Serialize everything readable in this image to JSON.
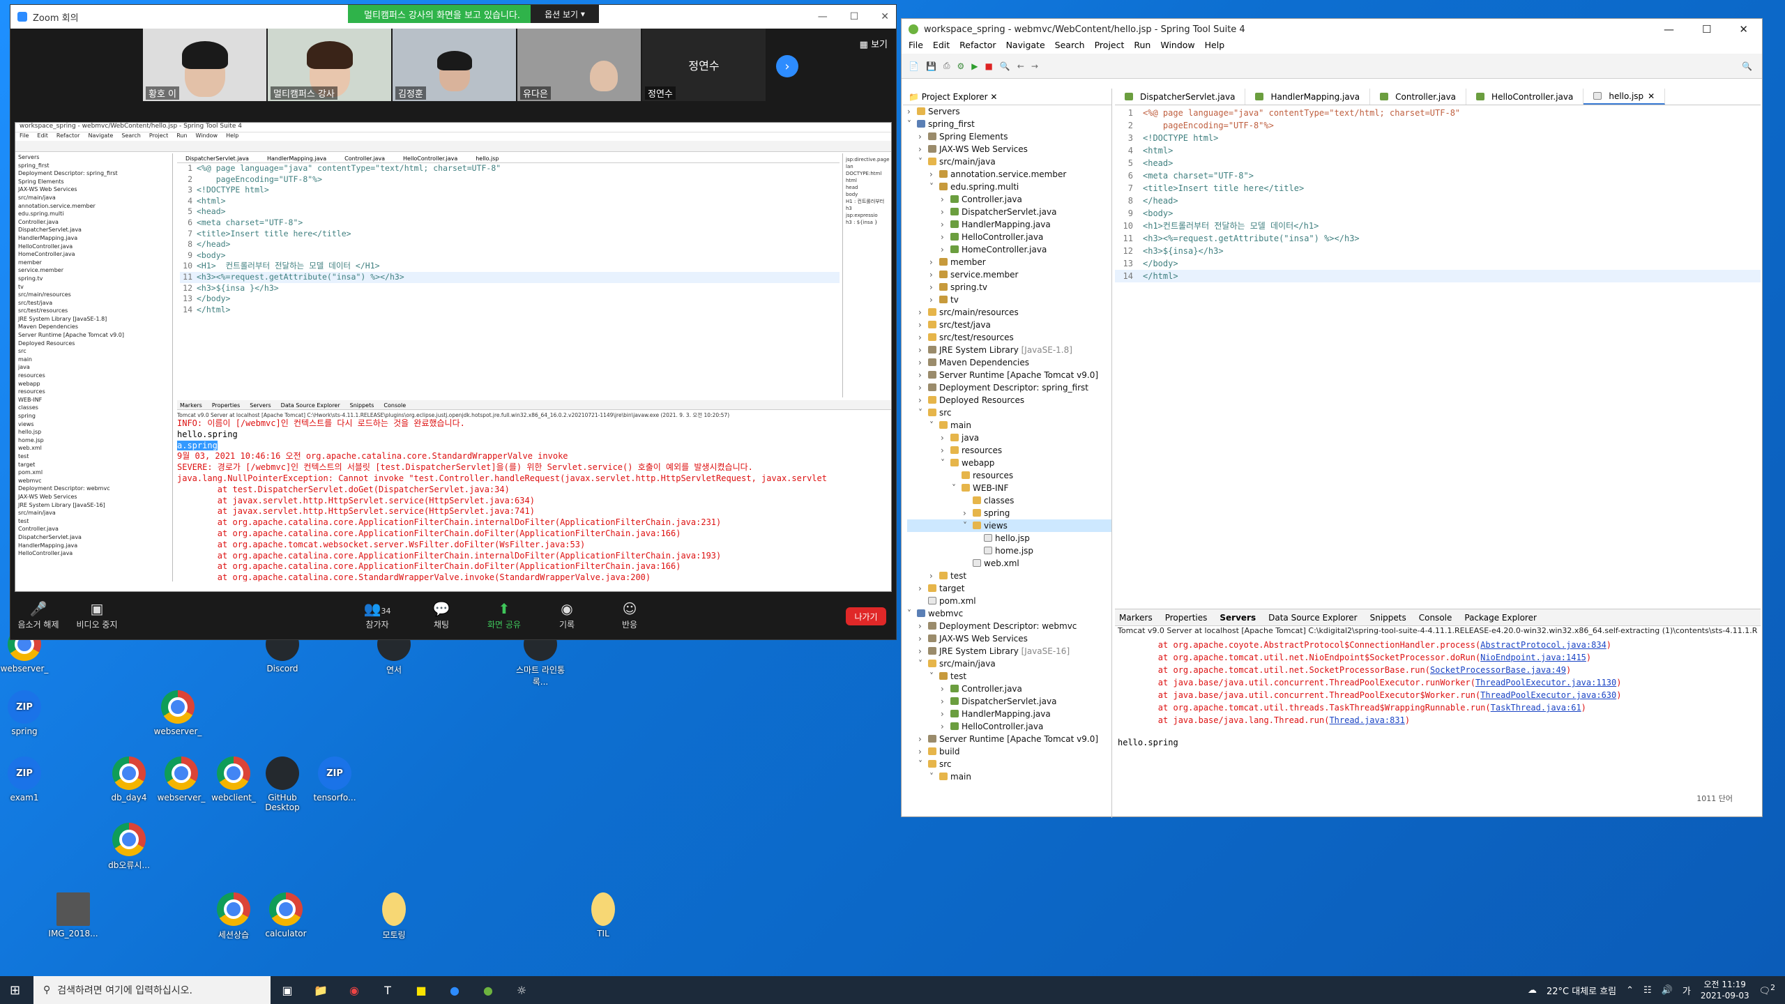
{
  "desktop": {
    "icons": [
      {
        "label": "webserver_",
        "type": "chrome"
      },
      {
        "label": "Discord",
        "type": "app"
      },
      {
        "label": "연서",
        "type": "app"
      },
      {
        "label": "스마트 라인통록...",
        "type": "app"
      },
      {
        "label": "spring",
        "type": "zip"
      },
      {
        "label": "webserver_",
        "type": "chrome"
      },
      {
        "label": "exam1",
        "type": "zip"
      },
      {
        "label": "db_day4",
        "type": "chrome"
      },
      {
        "label": "webserver_",
        "type": "chrome"
      },
      {
        "label": "webclient_",
        "type": "chrome"
      },
      {
        "label": "GitHub Desktop",
        "type": "app"
      },
      {
        "label": "tensorfo...",
        "type": "zip"
      },
      {
        "label": "db오류시...",
        "type": "chrome"
      },
      {
        "label": "IMG_2018...",
        "type": "image"
      },
      {
        "label": "세션상습",
        "type": "chrome"
      },
      {
        "label": "calculator",
        "type": "chrome"
      },
      {
        "label": "모토링",
        "type": "file"
      },
      {
        "label": "TIL",
        "type": "file"
      }
    ]
  },
  "zoom": {
    "title": "Zoom 회의",
    "share_banner": "멀티캠퍼스 강사의 화면을 보고 있습니다.",
    "share_option": "옵션 보기",
    "view_label": "보기",
    "participants": [
      "황호 이",
      "멀티캠퍼스 강사",
      "김정훈",
      "유다은",
      "정연수"
    ],
    "big_name": "정연수",
    "toolbar": {
      "mute": "음소거 해제",
      "video": "비디오 중지",
      "participants": "참가자",
      "participant_count": "34",
      "chat": "채팅",
      "share": "화면 공유",
      "record": "기록",
      "reactions": "반응",
      "leave": "나가기"
    }
  },
  "inner_sts": {
    "title": "workspace_spring - webmvc/WebContent/hello.jsp - Spring Tool Suite 4",
    "menu": [
      "File",
      "Edit",
      "Refactor",
      "Navigate",
      "Search",
      "Project",
      "Run",
      "Window",
      "Help"
    ],
    "tabs": [
      "DispatcherServlet.java",
      "HandlerMapping.java",
      "Controller.java",
      "HelloController.java",
      "hello.jsp"
    ],
    "tree": [
      "Servers",
      "spring_first",
      "Deployment Descriptor: spring_first",
      "Spring Elements",
      "JAX-WS Web Services",
      "src/main/java",
      "annotation.service.member",
      "edu.spring.multi",
      "Controller.java",
      "DispatcherServlet.java",
      "HandlerMapping.java",
      "HelloController.java",
      "HomeController.java",
      "member",
      "service.member",
      "spring.tv",
      "tv",
      "src/main/resources",
      "src/test/java",
      "src/test/resources",
      "JRE System Library [JavaSE-1.8]",
      "Maven Dependencies",
      "Server Runtime [Apache Tomcat v9.0]",
      "Deployed Resources",
      "src",
      "main",
      "java",
      "resources",
      "webapp",
      "resources",
      "WEB-INF",
      "classes",
      "spring",
      "views",
      "hello.jsp",
      "home.jsp",
      "web.xml",
      "test",
      "target",
      "pom.xml",
      "webmvc",
      "Deployment Descriptor: webmvc",
      "JAX-WS Web Services",
      "JRE System Library [JavaSE-16]",
      "src/main/java",
      "test",
      "Controller.java",
      "DispatcherServlet.java",
      "HandlerMapping.java",
      "HelloController.java"
    ],
    "code": [
      "<%@ page language=\"java\" contentType=\"text/html; charset=UTF-8\"",
      "    pageEncoding=\"UTF-8\"%>",
      "<!DOCTYPE html>",
      "<html>",
      "<head>",
      "<meta charset=\"UTF-8\">",
      "<title>Insert title here</title>",
      "</head>",
      "<body>",
      "<H1>  컨트롤러부터 전달하는 모델 데이터 </H1>",
      "<h3><%=request.getAttribute(\"insa\") %></h3>",
      "<h3>${insa }</h3>",
      "</body>",
      "</html>"
    ],
    "outline": [
      "jsp:directive.page lan",
      "DOCTYPE:html",
      "html",
      "head",
      "body",
      "H1 : 컨트롤러부터",
      "h3",
      "jsp:expressio",
      "h3 : ${insa }"
    ],
    "console_tabs": [
      "Markers",
      "Properties",
      "Servers",
      "Data Source Explorer",
      "Snippets",
      "Console"
    ],
    "console_info": "Tomcat v9.0 Server at localhost [Apache Tomcat] C:\\Hwork\\sts-4.11.1.RELEASE\\plugins\\org.eclipse.justj.openjdk.hotspot.jre.full.win32.x86_64_16.0.2.v20210721-1149\\jre\\bin\\javaw.exe  (2021. 9. 3. 오전 10:20:57)",
    "console": [
      {
        "t": "INFO: 이름이 [/webmvc]인 컨텍스트를 다시 로드하는 것을 완료했습니다.",
        "c": "red"
      },
      {
        "t": "hello.spring",
        "c": "black"
      },
      {
        "t": "a.spring",
        "c": "sel"
      },
      {
        "t": "9월 03, 2021 10:46:16 오전 org.apache.catalina.core.StandardWrapperValve invoke",
        "c": "red"
      },
      {
        "t": "SEVERE: 경로가 [/webmvc]인 컨텍스트의 서블릿 [test.DispatcherServlet]을(를) 위한 Servlet.service() 호출이 예외를 발생시켰습니다.",
        "c": "red"
      },
      {
        "t": "java.lang.NullPointerException: Cannot invoke \"test.Controller.handleRequest(javax.servlet.http.HttpServletRequest, javax.servlet",
        "c": "red"
      },
      {
        "t": "        at test.DispatcherServlet.doGet(DispatcherServlet.java:34)",
        "c": "red"
      },
      {
        "t": "        at javax.servlet.http.HttpServlet.service(HttpServlet.java:634)",
        "c": "red"
      },
      {
        "t": "        at javax.servlet.http.HttpServlet.service(HttpServlet.java:741)",
        "c": "red"
      },
      {
        "t": "        at org.apache.catalina.core.ApplicationFilterChain.internalDoFilter(ApplicationFilterChain.java:231)",
        "c": "red"
      },
      {
        "t": "        at org.apache.catalina.core.ApplicationFilterChain.doFilter(ApplicationFilterChain.java:166)",
        "c": "red"
      },
      {
        "t": "        at org.apache.tomcat.websocket.server.WsFilter.doFilter(WsFilter.java:53)",
        "c": "red"
      },
      {
        "t": "        at org.apache.catalina.core.ApplicationFilterChain.internalDoFilter(ApplicationFilterChain.java:193)",
        "c": "red"
      },
      {
        "t": "        at org.apache.catalina.core.ApplicationFilterChain.doFilter(ApplicationFilterChain.java:166)",
        "c": "red"
      },
      {
        "t": "        at org.apache.catalina.core.StandardWrapperValve.invoke(StandardWrapperValve.java:200)",
        "c": "red"
      }
    ]
  },
  "sts": {
    "title": "workspace_spring - webmvc/WebContent/hello.jsp - Spring Tool Suite 4",
    "menu": [
      "File",
      "Edit",
      "Refactor",
      "Navigate",
      "Search",
      "Project",
      "Run",
      "Window",
      "Help"
    ],
    "explorer_title": "Project Explorer",
    "tree": [
      {
        "d": 0,
        "t": "Servers",
        "i": "fld",
        "a": ">"
      },
      {
        "d": 0,
        "t": "spring_first",
        "i": "prj",
        "a": "v"
      },
      {
        "d": 1,
        "t": "Spring Elements",
        "i": "lib",
        "a": ">"
      },
      {
        "d": 1,
        "t": "JAX-WS Web Services",
        "i": "lib",
        "a": ">"
      },
      {
        "d": 1,
        "t": "src/main/java",
        "i": "fld",
        "a": "v"
      },
      {
        "d": 2,
        "t": "annotation.service.member",
        "i": "pkg",
        "a": ">"
      },
      {
        "d": 2,
        "t": "edu.spring.multi",
        "i": "pkg",
        "a": "v"
      },
      {
        "d": 3,
        "t": "Controller.java",
        "i": "java",
        "a": ">"
      },
      {
        "d": 3,
        "t": "DispatcherServlet.java",
        "i": "java",
        "a": ">"
      },
      {
        "d": 3,
        "t": "HandlerMapping.java",
        "i": "java",
        "a": ">"
      },
      {
        "d": 3,
        "t": "HelloController.java",
        "i": "java",
        "a": ">"
      },
      {
        "d": 3,
        "t": "HomeController.java",
        "i": "java",
        "a": ">"
      },
      {
        "d": 2,
        "t": "member",
        "i": "pkg",
        "a": ">"
      },
      {
        "d": 2,
        "t": "service.member",
        "i": "pkg",
        "a": ">"
      },
      {
        "d": 2,
        "t": "spring.tv",
        "i": "pkg",
        "a": ">"
      },
      {
        "d": 2,
        "t": "tv",
        "i": "pkg",
        "a": ">"
      },
      {
        "d": 1,
        "t": "src/main/resources",
        "i": "fld",
        "a": ">"
      },
      {
        "d": 1,
        "t": "src/test/java",
        "i": "fld",
        "a": ">"
      },
      {
        "d": 1,
        "t": "src/test/resources",
        "i": "fld",
        "a": ">"
      },
      {
        "d": 1,
        "t": "JRE System Library",
        "x": "[JavaSE-1.8]",
        "i": "lib",
        "a": ">"
      },
      {
        "d": 1,
        "t": "Maven Dependencies",
        "i": "lib",
        "a": ">"
      },
      {
        "d": 1,
        "t": "Server Runtime [Apache Tomcat v9.0]",
        "i": "lib",
        "a": ">"
      },
      {
        "d": 1,
        "t": "Deployment Descriptor: spring_first",
        "i": "lib",
        "a": ">"
      },
      {
        "d": 1,
        "t": "Deployed Resources",
        "i": "fld",
        "a": ">"
      },
      {
        "d": 1,
        "t": "src",
        "i": "fld",
        "a": "v"
      },
      {
        "d": 2,
        "t": "main",
        "i": "fld",
        "a": "v"
      },
      {
        "d": 3,
        "t": "java",
        "i": "fld",
        "a": ">"
      },
      {
        "d": 3,
        "t": "resources",
        "i": "fld",
        "a": ">"
      },
      {
        "d": 3,
        "t": "webapp",
        "i": "fld",
        "a": "v"
      },
      {
        "d": 4,
        "t": "resources",
        "i": "fld",
        "a": ""
      },
      {
        "d": 4,
        "t": "WEB-INF",
        "i": "fld",
        "a": "v"
      },
      {
        "d": 5,
        "t": "classes",
        "i": "fld",
        "a": ""
      },
      {
        "d": 5,
        "t": "spring",
        "i": "fld",
        "a": ">"
      },
      {
        "d": 5,
        "t": "views",
        "i": "fld",
        "a": "v",
        "sel": true
      },
      {
        "d": 6,
        "t": "hello.jsp",
        "i": "xml",
        "a": ""
      },
      {
        "d": 6,
        "t": "home.jsp",
        "i": "xml",
        "a": ""
      },
      {
        "d": 5,
        "t": "web.xml",
        "i": "xml",
        "a": ""
      },
      {
        "d": 2,
        "t": "test",
        "i": "fld",
        "a": ">"
      },
      {
        "d": 1,
        "t": "target",
        "i": "fld",
        "a": ">"
      },
      {
        "d": 1,
        "t": "pom.xml",
        "i": "xml",
        "a": ""
      },
      {
        "d": 0,
        "t": "webmvc",
        "i": "prj",
        "a": "v"
      },
      {
        "d": 1,
        "t": "Deployment Descriptor: webmvc",
        "i": "lib",
        "a": ">"
      },
      {
        "d": 1,
        "t": "JAX-WS Web Services",
        "i": "lib",
        "a": ">"
      },
      {
        "d": 1,
        "t": "JRE System Library",
        "x": "[JavaSE-16]",
        "i": "lib",
        "a": ">"
      },
      {
        "d": 1,
        "t": "src/main/java",
        "i": "fld",
        "a": "v"
      },
      {
        "d": 2,
        "t": "test",
        "i": "pkg",
        "a": "v"
      },
      {
        "d": 3,
        "t": "Controller.java",
        "i": "java",
        "a": ">"
      },
      {
        "d": 3,
        "t": "DispatcherServlet.java",
        "i": "java",
        "a": ">"
      },
      {
        "d": 3,
        "t": "HandlerMapping.java",
        "i": "java",
        "a": ">"
      },
      {
        "d": 3,
        "t": "HelloController.java",
        "i": "java",
        "a": ">"
      },
      {
        "d": 1,
        "t": "Server Runtime [Apache Tomcat v9.0]",
        "i": "lib",
        "a": ">"
      },
      {
        "d": 1,
        "t": "build",
        "i": "fld",
        "a": ">"
      },
      {
        "d": 1,
        "t": "src",
        "i": "fld",
        "a": "v"
      },
      {
        "d": 2,
        "t": "main",
        "i": "fld",
        "a": "v"
      }
    ],
    "tabs": [
      "DispatcherServlet.java",
      "HandlerMapping.java",
      "Controller.java",
      "HelloController.java",
      "hello.jsp"
    ],
    "code": [
      "<%@ page language=\"java\" contentType=\"text/html; charset=UTF-8\"",
      "    pageEncoding=\"UTF-8\"%>",
      "<!DOCTYPE html>",
      "<html>",
      "<head>",
      "<meta charset=\"UTF-8\">",
      "<title>Insert title here</title>",
      "</head>",
      "<body>",
      "<h1>컨트롤러부터 전달하는 모델 데이터</h1>",
      "<h3><%=request.getAttribute(\"insa\") %></h3>",
      "<h3>${insa}</h3>",
      "</body>",
      "</html>"
    ],
    "console_tabs": [
      "Markers",
      "Properties",
      "Servers",
      "Data Source Explorer",
      "Snippets",
      "Console",
      "Package Explorer"
    ],
    "console_info": "Tomcat v9.0 Server at localhost [Apache Tomcat] C:\\kdigital2\\spring-tool-suite-4-4.11.1.RELEASE-e4.20.0-win32.win32.x86_64.self-extracting (1)\\contents\\sts-4.11.1.R",
    "console": [
      {
        "p": "        at org.apache.coyote.AbstractProtocol$ConnectionHandler.process(",
        "l": "AbstractProtocol.java:834",
        "s": ")"
      },
      {
        "p": "        at org.apache.tomcat.util.net.NioEndpoint$SocketProcessor.doRun(",
        "l": "NioEndpoint.java:1415",
        "s": ")"
      },
      {
        "p": "        at org.apache.tomcat.util.net.SocketProcessorBase.run(",
        "l": "SocketProcessorBase.java:49",
        "s": ")"
      },
      {
        "p": "        at java.base/java.util.concurrent.ThreadPoolExecutor.runWorker(",
        "l": "ThreadPoolExecutor.java:1130",
        "s": ")"
      },
      {
        "p": "        at java.base/java.util.concurrent.ThreadPoolExecutor$Worker.run(",
        "l": "ThreadPoolExecutor.java:630",
        "s": ")"
      },
      {
        "p": "        at org.apache.tomcat.util.threads.TaskThread$WrappingRunnable.run(",
        "l": "TaskThread.java:61",
        "s": ")"
      },
      {
        "p": "        at java.base/java.lang.Thread.run(",
        "l": "Thread.java:831",
        "s": ")"
      }
    ],
    "console_out": "hello.spring",
    "status_count": "1011 단어"
  },
  "taskbar": {
    "search_placeholder": "검색하려면 여기에 입력하십시오.",
    "weather": "22°C  대체로 흐림",
    "ime": "가",
    "time": "오전 11:19",
    "date": "2021-09-03",
    "notif_count": "2"
  }
}
